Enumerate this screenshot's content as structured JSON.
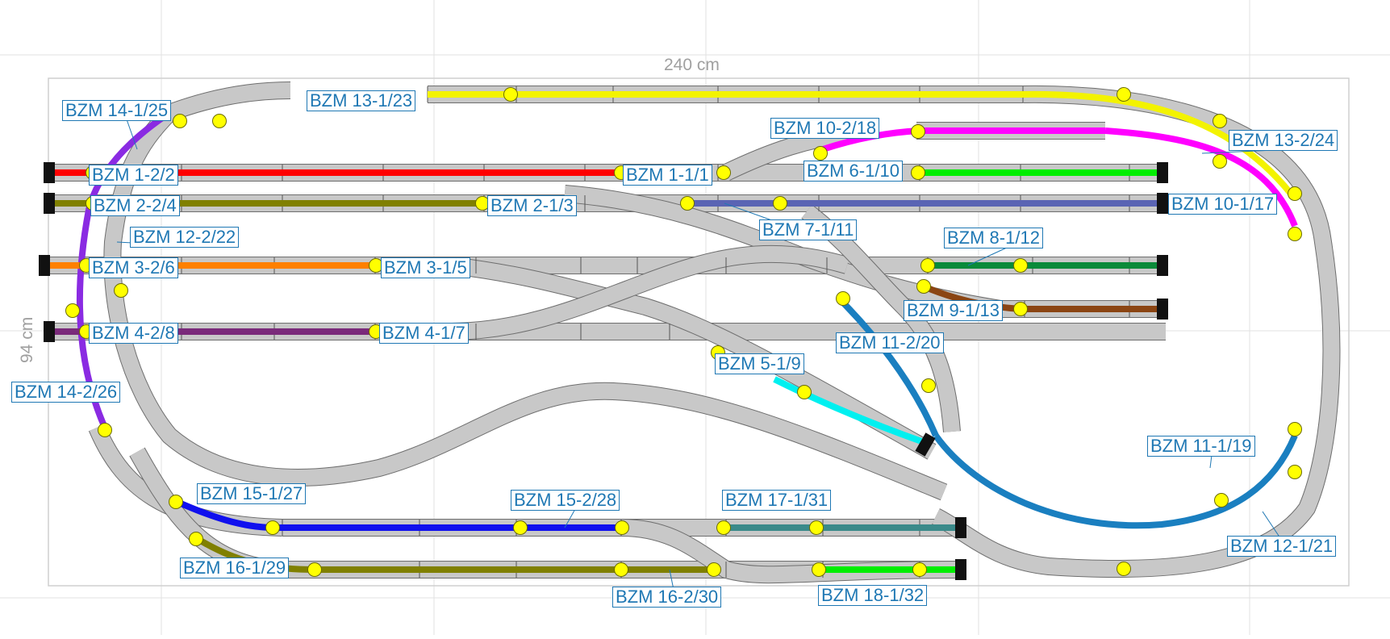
{
  "dimensions": {
    "width_label": "240 cm",
    "height_label": "94 cm"
  },
  "colors": {
    "track_bed": "#c8c8c8",
    "track_edge": "#6e6e6e",
    "grid": "#e2e2e2",
    "contact": "#ffff00",
    "label": "#1f78b4",
    "buffer": "#111111"
  },
  "blocks": [
    {
      "id": "b13_1",
      "name": "BZM 13-1/23",
      "color": "#f3f300"
    },
    {
      "id": "b13_2",
      "name": "BZM 13-2/24",
      "color": "#f3f300"
    },
    {
      "id": "b14_1",
      "name": "BZM 14-1/25",
      "color": "#8a2be2"
    },
    {
      "id": "b14_2",
      "name": "BZM 14-2/26",
      "color": "#8a2be2"
    },
    {
      "id": "b10_2",
      "name": "BZM 10-2/18",
      "color": "#ff00ff"
    },
    {
      "id": "b10_1",
      "name": "BZM 10-1/17",
      "color": "#ff00ff"
    },
    {
      "id": "b1_1",
      "name": "BZM 1-1/1",
      "color": "#ff0000"
    },
    {
      "id": "b1_2",
      "name": "BZM 1-2/2",
      "color": "#ff0000"
    },
    {
      "id": "b6_1",
      "name": "BZM 6-1/10",
      "color": "#00ee00"
    },
    {
      "id": "b2_1",
      "name": "BZM 2-1/3",
      "color": "#808000"
    },
    {
      "id": "b2_2",
      "name": "BZM 2-2/4",
      "color": "#808000"
    },
    {
      "id": "b7_1",
      "name": "BZM 7-1/11",
      "color": "#5a64b4"
    },
    {
      "id": "b12_2",
      "name": "BZM 12-2/22",
      "color": "#f2f2f2"
    },
    {
      "id": "b12_1",
      "name": "BZM 12-1/21",
      "color": "#f2f2f2"
    },
    {
      "id": "b8_1",
      "name": "BZM 8-1/12",
      "color": "#0a8a3a"
    },
    {
      "id": "b3_1",
      "name": "BZM 3-1/5",
      "color": "#ff8000"
    },
    {
      "id": "b3_2",
      "name": "BZM 3-2/6",
      "color": "#ff8000"
    },
    {
      "id": "b9_1",
      "name": "BZM 9-1/13",
      "color": "#8b4513"
    },
    {
      "id": "b4_1",
      "name": "BZM 4-1/7",
      "color": "#7a2a7a"
    },
    {
      "id": "b4_2",
      "name": "BZM 4-2/8",
      "color": "#7a2a7a"
    },
    {
      "id": "b11_2",
      "name": "BZM 11-2/20",
      "color": "#1a7fc0"
    },
    {
      "id": "b11_1",
      "name": "BZM 11-1/19",
      "color": "#1a7fc0"
    },
    {
      "id": "b5_1",
      "name": "BZM 5-1/9",
      "color": "#00f0f0"
    },
    {
      "id": "b15_1",
      "name": "BZM 15-1/27",
      "color": "#1010ee"
    },
    {
      "id": "b15_2",
      "name": "BZM 15-2/28",
      "color": "#1010ee"
    },
    {
      "id": "b17_1",
      "name": "BZM 17-1/31",
      "color": "#3a8a8a"
    },
    {
      "id": "b16_1",
      "name": "BZM 16-1/29",
      "color": "#808000"
    },
    {
      "id": "b16_2",
      "name": "BZM 16-2/30",
      "color": "#808000"
    },
    {
      "id": "b18_1",
      "name": "BZM 18-1/32",
      "color": "#00ee00"
    }
  ]
}
